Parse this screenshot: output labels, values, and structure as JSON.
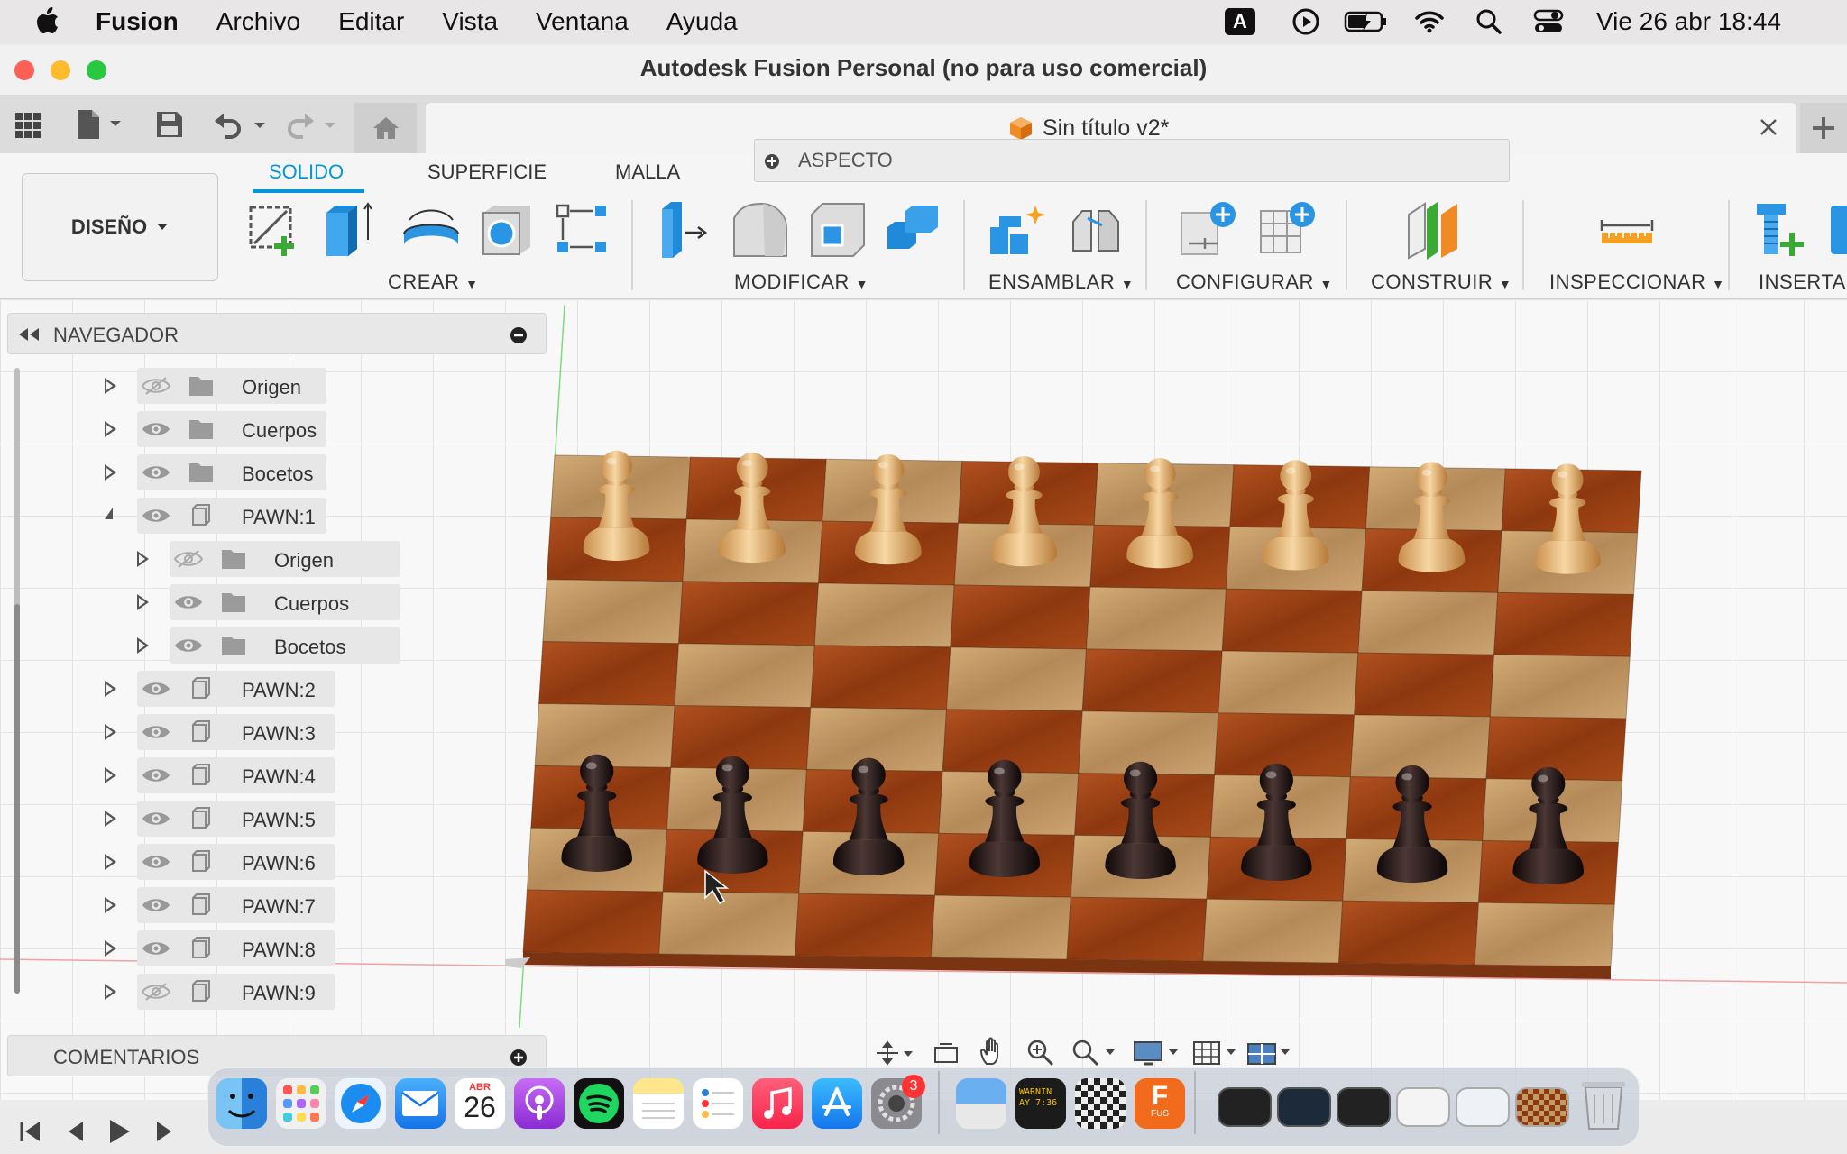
{
  "menubar": {
    "app_name": "Fusion",
    "items": [
      "Archivo",
      "Editar",
      "Vista",
      "Ventana",
      "Ayuda"
    ],
    "input_indicator": "A",
    "clock": "Vie 26 abr 18:44"
  },
  "window": {
    "title": "Autodesk Fusion Personal (no para uso comercial)",
    "document_tab": "Sin título v2*"
  },
  "search_bar": {
    "label": "ASPECTO"
  },
  "workspace": {
    "label": "DISEÑO"
  },
  "ribbon": {
    "tabs": [
      "SOLIDO",
      "SUPERFICIE",
      "MALLA"
    ],
    "active_tab": "SOLIDO",
    "groups": [
      "CREAR",
      "MODIFICAR",
      "ENSAMBLAR",
      "CONFIGURAR",
      "CONSTRUIR",
      "INSPECCIONAR",
      "INSERTAR"
    ]
  },
  "navigator": {
    "title": "NAVEGADOR",
    "items": [
      {
        "label": "Origen",
        "visible": false
      },
      {
        "label": "Cuerpos",
        "visible": true
      },
      {
        "label": "Bocetos",
        "visible": true
      },
      {
        "label": "PAWN:1",
        "visible": true
      },
      {
        "label": "Origen",
        "visible": false
      },
      {
        "label": "Cuerpos",
        "visible": true
      },
      {
        "label": "Bocetos",
        "visible": true
      },
      {
        "label": "PAWN:2",
        "visible": true
      },
      {
        "label": "PAWN:3",
        "visible": true
      },
      {
        "label": "PAWN:4",
        "visible": true
      },
      {
        "label": "PAWN:5",
        "visible": true
      },
      {
        "label": "PAWN:6",
        "visible": true
      },
      {
        "label": "PAWN:7",
        "visible": true
      },
      {
        "label": "PAWN:8",
        "visible": true
      },
      {
        "label": "PAWN:9",
        "visible": false
      }
    ]
  },
  "comments": {
    "title": "COMENTARIOS"
  },
  "dock": {
    "calendar_month": "ABR",
    "calendar_day": "26",
    "settings_badge": "3",
    "console_text": "WARNIN\nAY 7:36",
    "fusion_label": "FUS"
  },
  "colors": {
    "accent": "#0696d7",
    "board_dark": "#9b3f14",
    "board_light": "#c29a66",
    "piece_light": "#e5b77a",
    "piece_dark": "#2a1c1b"
  }
}
